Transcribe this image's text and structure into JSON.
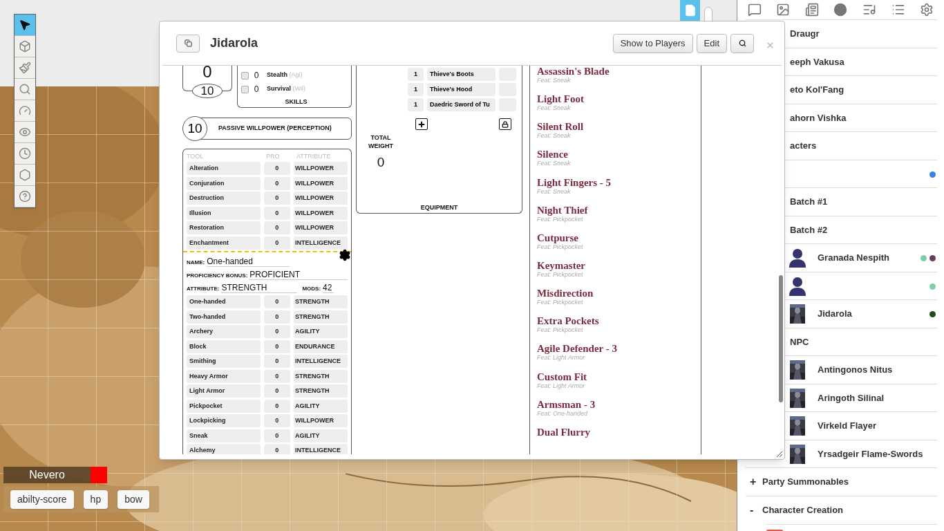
{
  "toolbar": [
    {
      "selected": true
    },
    {
      "selected": false
    },
    {
      "selected": false
    },
    {
      "selected": false
    },
    {
      "selected": false
    },
    {
      "selected": false
    },
    {
      "selected": false
    },
    {
      "selected": false
    },
    {
      "selected": false
    }
  ],
  "dialog": {
    "title": "Jidarola",
    "buttons": [
      "Show to Players",
      "Edit"
    ]
  },
  "ability": {
    "score": "0",
    "modifier": "10"
  },
  "skills": {
    "title": "SKILLS",
    "items": [
      {
        "value": "0",
        "name": "Stealth",
        "attribute": "(Agi)",
        "checked": false
      },
      {
        "value": "0",
        "name": "Survival",
        "attribute": "(Wil)",
        "checked": false
      }
    ]
  },
  "passive": {
    "value": "10",
    "label": "PASSIVE WILLPOWER (PERCEPTION)"
  },
  "tools": {
    "columns": [
      "TOOL",
      "PRO",
      "ATTRIBUTE"
    ],
    "rows": [
      {
        "name": "Alteration",
        "pro": "0",
        "attribute": "WILLPOWER"
      },
      {
        "name": "Conjuration",
        "pro": "0",
        "attribute": "WILLPOWER"
      },
      {
        "name": "Destruction",
        "pro": "0",
        "attribute": "WILLPOWER"
      },
      {
        "name": "Illusion",
        "pro": "0",
        "attribute": "WILLPOWER"
      },
      {
        "name": "Restoration",
        "pro": "0",
        "attribute": "WILLPOWER"
      },
      {
        "name": "Enchantment",
        "pro": "0",
        "attribute": "INTELLIGENCE"
      }
    ],
    "editor": {
      "name_label": "NAME:",
      "name": "One-handed",
      "bonus_label": "PROFICIENCY BONUS:",
      "bonus": "PROFICIENT",
      "attribute_label": "ATTRIBUTE:",
      "attribute": "STRENGTH",
      "mods_label": "MODS:",
      "mods": "42"
    },
    "rows_after": [
      {
        "name": "One-handed",
        "pro": "0",
        "attribute": "STRENGTH"
      },
      {
        "name": "Two-handed",
        "pro": "0",
        "attribute": "STRENGTH"
      },
      {
        "name": "Archery",
        "pro": "0",
        "attribute": "AGILITY"
      },
      {
        "name": "Block",
        "pro": "0",
        "attribute": "ENDURANCE"
      },
      {
        "name": "Smithing",
        "pro": "0",
        "attribute": "INTELLIGENCE"
      },
      {
        "name": "Heavy Armor",
        "pro": "0",
        "attribute": "STRENGTH"
      },
      {
        "name": "Light Armor",
        "pro": "0",
        "attribute": "STRENGTH"
      },
      {
        "name": "Pickpocket",
        "pro": "0",
        "attribute": "AGILITY"
      },
      {
        "name": "Lockpicking",
        "pro": "0",
        "attribute": "WILLPOWER"
      },
      {
        "name": "Sneak",
        "pro": "0",
        "attribute": "AGILITY"
      },
      {
        "name": "Alchemy",
        "pro": "0",
        "attribute": "INTELLIGENCE"
      }
    ]
  },
  "equipment": {
    "title": "EQUIPMENT",
    "weight_label": "TOTAL WEIGHT",
    "weight": "0",
    "items": [
      {
        "qty": "1",
        "name": "Thieve's Boots"
      },
      {
        "qty": "1",
        "name": "Thieve's Hood"
      },
      {
        "qty": "1",
        "name": "Daedric Sword of Tu"
      }
    ]
  },
  "feats": [
    {
      "name": "Assassin's Blade",
      "source": "Feat: Sneak"
    },
    {
      "name": "Light Foot",
      "source": "Feat: Sneak"
    },
    {
      "name": "Silent Roll",
      "source": "Feat: Sneak"
    },
    {
      "name": "Silence",
      "source": "Feat: Sneak"
    },
    {
      "name": "Light Fingers - 5",
      "source": "Feat: Sneak"
    },
    {
      "name": "Night Thief",
      "source": "Feat: Pickpocket"
    },
    {
      "name": "Cutpurse",
      "source": "Feat: Pickpocket"
    },
    {
      "name": "Keymaster",
      "source": "Feat: Pickpocket"
    },
    {
      "name": "Misdirection",
      "source": "Feat: Pickpocket"
    },
    {
      "name": "Extra Pockets",
      "source": "Feat: Pickpocket"
    },
    {
      "name": "Agile Defender - 3",
      "source": "Feat: Light Armor"
    },
    {
      "name": "Custom Fit",
      "source": "Feat: Light Armor"
    },
    {
      "name": "Armsman - 3",
      "source": "Feat: One-handed"
    },
    {
      "name": "Dual Flurry"
    }
  ],
  "token": {
    "name": "Nevero",
    "buttons": [
      "abilty-score",
      "hp",
      "bow"
    ]
  },
  "sidebar": {
    "rows": [
      {
        "kind": "folder",
        "label": "Draugr"
      },
      {
        "kind": "folder",
        "label": "eeph Vakusa"
      },
      {
        "kind": "folder",
        "label": "eto Kol'Fang"
      },
      {
        "kind": "folder",
        "label": "ahorn Vishka"
      },
      {
        "kind": "folder",
        "label": "acters"
      },
      {
        "kind": "blank",
        "dots": [
          {
            "color": "#3b82e0"
          }
        ]
      },
      {
        "kind": "folder",
        "label": "Batch #1"
      },
      {
        "kind": "folder",
        "label": "Batch #2"
      },
      {
        "kind": "character",
        "avatar": {
          "kind": "silhouette"
        },
        "label": "Granada Nespith",
        "dots": [
          {
            "color": "#7ecfa8"
          },
          {
            "color": "#6b3b5e"
          }
        ]
      },
      {
        "kind": "character",
        "avatar": {
          "kind": "silhouette"
        },
        "dots": [
          {
            "color": "#7ecfa8"
          }
        ]
      },
      {
        "kind": "character",
        "avatar": {
          "kind": "picture"
        },
        "label": "Jidarola",
        "dots": [
          {
            "color": "#1f4a1a"
          }
        ]
      },
      {
        "kind": "folder",
        "label": "NPC"
      },
      {
        "kind": "character",
        "avatar": {
          "kind": "picture"
        },
        "label": "Antingonos Nitus"
      },
      {
        "kind": "character",
        "avatar": {
          "kind": "picture"
        },
        "label": "Aringoth Silinal"
      },
      {
        "kind": "character",
        "avatar": {
          "kind": "picture"
        },
        "label": "Virkeld Flayer"
      },
      {
        "kind": "character",
        "avatar": {
          "kind": "picture"
        },
        "label": "Yrsadgeir Flame-Swords"
      }
    ],
    "sections": [
      {
        "sign": "+",
        "label": "Party Summonables"
      },
      {
        "sign": "-",
        "label": "Character Creation"
      }
    ]
  }
}
